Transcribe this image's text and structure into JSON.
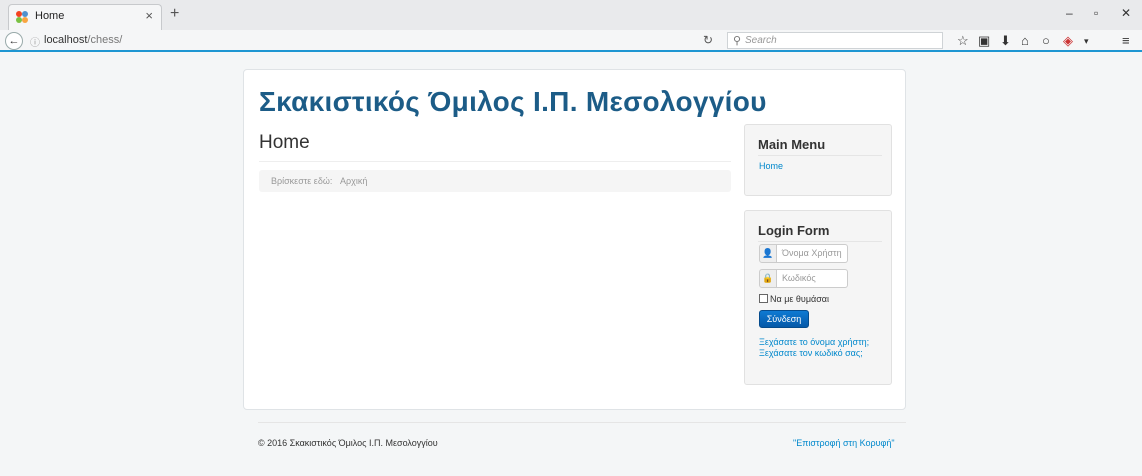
{
  "browser": {
    "tab_title": "Home",
    "tab_close": "×",
    "new_tab": "+",
    "url_host": "localhost",
    "url_path": "/chess/",
    "search_placeholder": "Search",
    "window_controls": {
      "minimize": "–",
      "maximize": "▫",
      "close": "✕"
    }
  },
  "site": {
    "title": "Σκακιστικός Όμιλος Ι.Π. Μεσολογγίου"
  },
  "content": {
    "heading": "Home",
    "breadcrumb_label": "Βρίσκεστε εδώ:",
    "breadcrumb_item": "Αρχική"
  },
  "main_menu": {
    "title": "Main Menu",
    "items": [
      "Home"
    ]
  },
  "login_form": {
    "title": "Login Form",
    "username_placeholder": "Όνομα Χρήστη",
    "password_placeholder": "Κωδικός",
    "remember_label": "Να με θυμάσαι",
    "submit_label": "Σύνδεση",
    "forgot_username": "Ξεχάσατε το όνομα χρήστη;",
    "forgot_password": "Ξεχάσατε τον κωδικό σας;"
  },
  "footer": {
    "copyright": "© 2016 Σκακιστικός Όμιλος Ι.Π. Μεσολογγίου",
    "back_to_top": "\"Επιστροφή στη Κορυφή\""
  },
  "colors": {
    "accent": "#1e96d2",
    "title": "#1c5c87",
    "link": "#0088cc",
    "button": "#0559a8"
  }
}
